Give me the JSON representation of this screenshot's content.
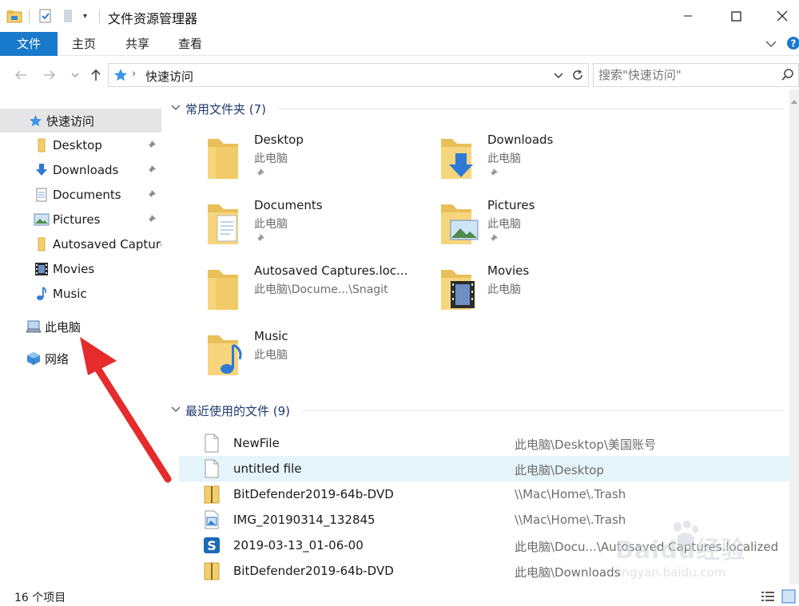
{
  "window": {
    "title": "文件资源管理器"
  },
  "ribbon": {
    "tabs": [
      "文件",
      "主页",
      "共享",
      "查看"
    ]
  },
  "address": {
    "location": "快速访问",
    "search_placeholder": "搜索\"快速访问\""
  },
  "nav": {
    "quick_access": "快速访问",
    "items": [
      "Desktop",
      "Downloads",
      "Documents",
      "Pictures",
      "Autosaved Captures",
      "Movies",
      "Music"
    ],
    "this_pc": "此电脑",
    "network": "网络"
  },
  "frequent": {
    "header": "常用文件夹 (7)",
    "folders": [
      {
        "name": "Desktop",
        "location": "此电脑"
      },
      {
        "name": "Downloads",
        "location": "此电脑"
      },
      {
        "name": "Documents",
        "location": "此电脑"
      },
      {
        "name": "Pictures",
        "location": "此电脑"
      },
      {
        "name": "Autosaved Captures.loc...",
        "location": "此电脑\\Docume...\\Snagit"
      },
      {
        "name": "Movies",
        "location": "此电脑"
      },
      {
        "name": "Music",
        "location": "此电脑"
      }
    ]
  },
  "recent": {
    "header": "最近使用的文件 (9)",
    "files": [
      {
        "name": "NewFile",
        "path": "此电脑\\Desktop\\美国账号"
      },
      {
        "name": "untitled file",
        "path": "此电脑\\Desktop"
      },
      {
        "name": "BitDefender2019-64b-DVD",
        "path": "\\\\Mac\\Home\\.Trash"
      },
      {
        "name": "IMG_20190314_132845",
        "path": "\\\\Mac\\Home\\.Trash"
      },
      {
        "name": "2019-03-13_01-06-00",
        "path": "此电脑\\Docu...\\Autosaved Captures.localized"
      },
      {
        "name": "BitDefender2019-64b-DVD",
        "path": "此电脑\\Downloads"
      }
    ]
  },
  "status": {
    "item_count": "16 个项目"
  },
  "watermark": {
    "brand": "Baidu经验",
    "url": "jingyan.baidu.com"
  },
  "colors": {
    "accent": "#1979ca",
    "folder": "#f3cf6b",
    "annotation_arrow": "#e52b2b"
  }
}
